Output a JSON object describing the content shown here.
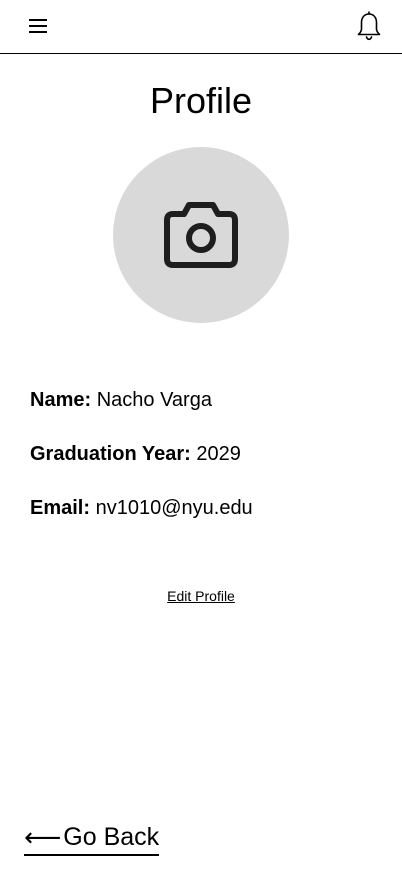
{
  "header": {
    "menu_icon": "hamburger-menu-icon",
    "notification_icon": "bell-icon"
  },
  "page": {
    "title": "Profile"
  },
  "avatar": {
    "icon": "camera-icon",
    "background": "#d9d9d9"
  },
  "profile": {
    "name_label": "Name:",
    "name_value": "Nacho Varga",
    "year_label": "Graduation Year:",
    "year_value": "2029",
    "email_label": "Email:",
    "email_value": "nv1010@nyu.edu"
  },
  "actions": {
    "edit_label": "Edit Profile",
    "back_arrow": "⟵",
    "back_label": "Go Back"
  }
}
